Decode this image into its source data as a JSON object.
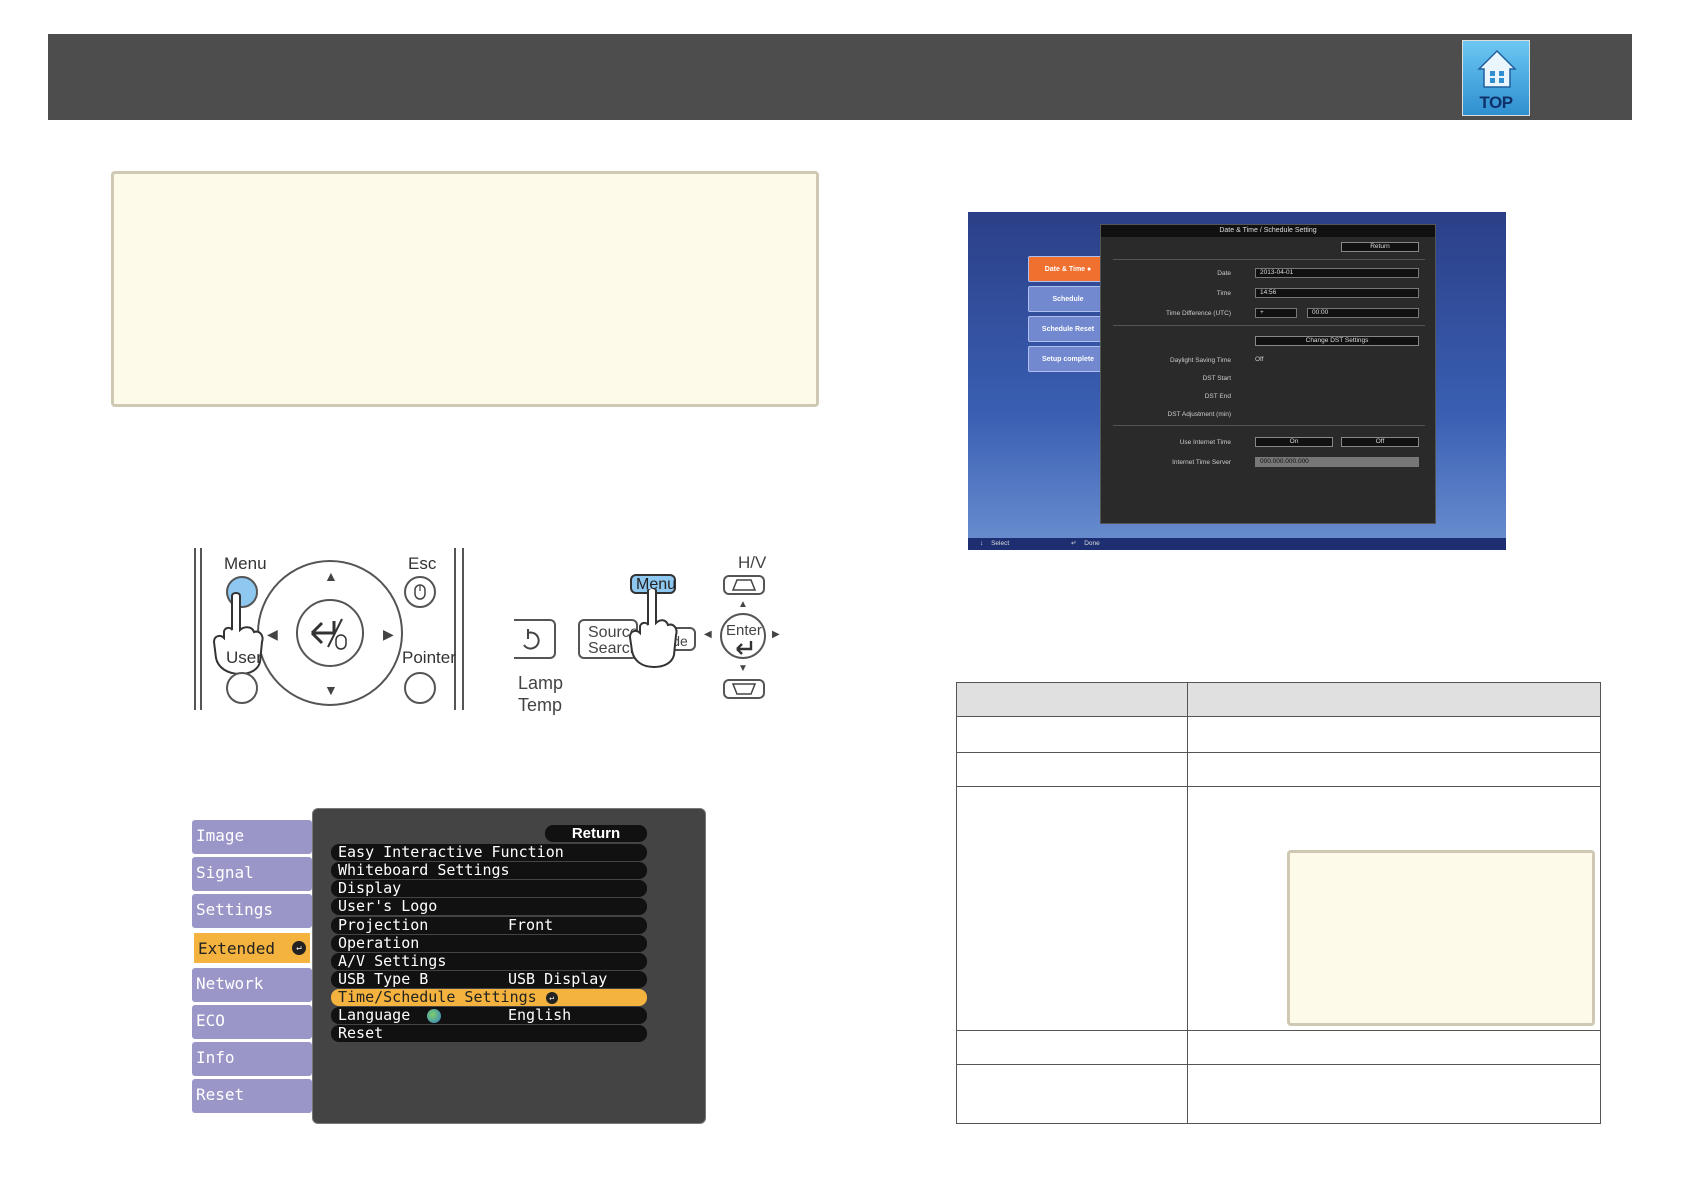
{
  "header": {
    "top_button_label": "TOP"
  },
  "remote_control": {
    "menu_label": "Menu",
    "esc_label": "Esc",
    "user_label": "User",
    "pointer_label": "Pointer"
  },
  "control_panel": {
    "menu_label": "Menu",
    "hv_label": "H/V",
    "source_search_line1": "Source",
    "source_search_line2": "Search",
    "wide_label": "Vide",
    "enter_label": "Enter",
    "lamp_label": "Lamp",
    "temp_label": "Temp"
  },
  "projector_menu": {
    "tabs": [
      "Image",
      "Signal",
      "Settings",
      "Extended",
      "Network",
      "ECO",
      "Info",
      "Reset"
    ],
    "active_tab": "Extended",
    "return_label": "Return",
    "items": [
      {
        "label": "Easy Interactive Function",
        "value": ""
      },
      {
        "label": "Whiteboard Settings",
        "value": ""
      },
      {
        "label": "Display",
        "value": ""
      },
      {
        "label": "User's Logo",
        "value": ""
      },
      {
        "label": "Projection",
        "value": "Front"
      },
      {
        "label": "Operation",
        "value": ""
      },
      {
        "label": "A/V Settings",
        "value": ""
      },
      {
        "label": "USB Type B",
        "value": "USB Display"
      },
      {
        "label": "Time/Schedule Settings",
        "value": ""
      },
      {
        "label": "Language",
        "value": "English"
      },
      {
        "label": "Reset",
        "value": ""
      }
    ],
    "selected_item": "Time/Schedule Settings"
  },
  "schedule_screen": {
    "title": "Date & Time / Schedule Setting",
    "return_label": "Return",
    "tabs": [
      "Date & Time",
      "Schedule",
      "Schedule Reset",
      "Setup complete"
    ],
    "active_tab": "Date & Time",
    "fields": {
      "date_label": "Date",
      "date_value": "2013-04-01",
      "time_label": "Time",
      "time_value": "14:56",
      "time_diff_label": "Time Difference (UTC)",
      "time_diff_sign": "+",
      "time_diff_value": "00:00",
      "change_dst_label": "Change DST Settings",
      "dst_label": "Daylight Saving Time",
      "dst_value": "Off",
      "dst_start_label": "DST Start",
      "dst_end_label": "DST End",
      "dst_adjust_label": "DST Adjustment (min)",
      "internet_time_label": "Use Internet Time",
      "internet_on": "On",
      "internet_off": "Off",
      "internet_server_label": "Internet Time Server",
      "internet_server_value": "000.000.000.000"
    },
    "status_select": "Select",
    "status_done": "Done"
  }
}
